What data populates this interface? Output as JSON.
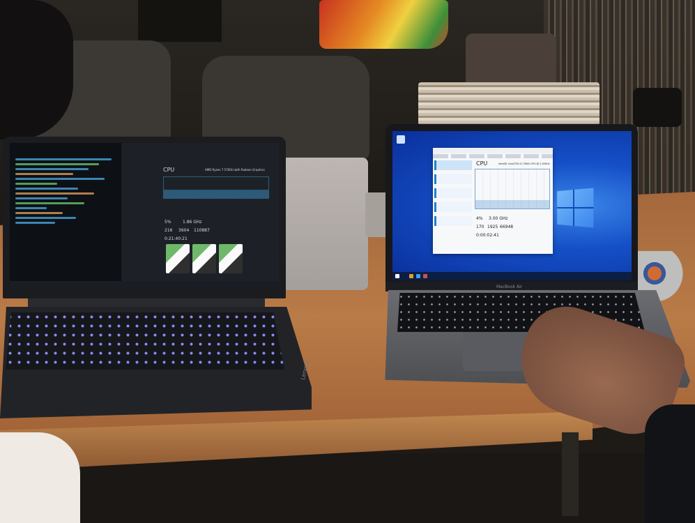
{
  "scene": {
    "lenovo_laptop": {
      "task_manager": {
        "heading": "CPU",
        "processor": "AMD Ryzen 7 5700U with Radeon Graphics",
        "utilization": "5%",
        "speed": "1.86 GHz",
        "processes": "216",
        "threads": "3604",
        "handles": "110887",
        "uptime": "0:21:40:21"
      },
      "brand_mark": "Lenovo"
    },
    "macbook": {
      "model_label": "MacBook Air",
      "task_manager": {
        "heading": "CPU",
        "processor": "Intel(R) Core(TM) i5-7360U CPU @ 2.30GHz",
        "utilization": "4%",
        "speed": "3.00 GHz",
        "processes": "170",
        "threads": "1925",
        "handles": "66948",
        "uptime": "0:00:02:41"
      }
    }
  },
  "colors": {
    "table": "#b97b47",
    "windows_desktop": "#1550c8",
    "keyboard_backlight": "#8b8dff"
  }
}
